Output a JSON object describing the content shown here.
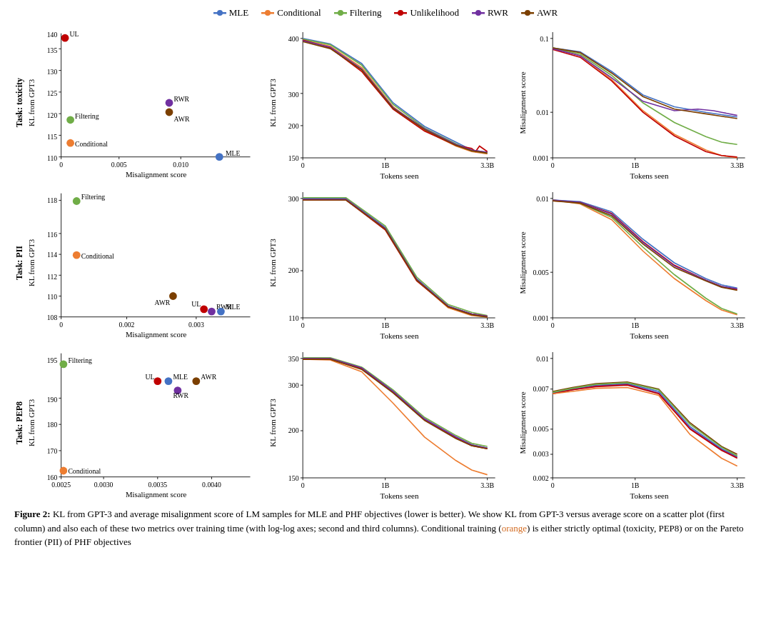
{
  "legend": {
    "items": [
      {
        "label": "MLE",
        "color": "#4472c4",
        "type": "line"
      },
      {
        "label": "Conditional",
        "color": "#ed7d31",
        "type": "line"
      },
      {
        "label": "Filtering",
        "color": "#70ad47",
        "type": "line"
      },
      {
        "label": "Unlikelihood",
        "color": "#c00000",
        "type": "line"
      },
      {
        "label": "RWR",
        "color": "#7030a0",
        "type": "line"
      },
      {
        "label": "AWR",
        "color": "#7b3f00",
        "type": "line"
      }
    ]
  },
  "rows": [
    {
      "label": "Task: toxicity"
    },
    {
      "label": "Task: PII"
    },
    {
      "label": "Task: PEP8"
    }
  ],
  "caption": "Figure 2: KL from GPT-3 and average misalignment score of LM samples for MLE and PHF objectives (lower is better). We show KL from GPT-3 versus average score on a scatter plot (first column) and also each of these two metrics over training time (with log-log axes; second and third columns). Conditional training (orange) is either strictly optimal (toxicity, PEP8) or on the Pareto frontier (PII) of PHF objectives"
}
